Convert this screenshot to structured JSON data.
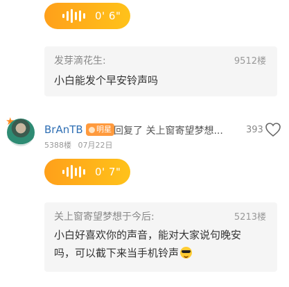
{
  "voice_messages": [
    {
      "duration": "0' 6\""
    },
    {
      "duration": "0' 7\""
    }
  ],
  "quotes": [
    {
      "author": "发芽滴花生:",
      "floor": "9512楼",
      "text": "小白能发个早安铃声吗"
    },
    {
      "author": "关上窗寄望梦想于今后:",
      "floor": "5213楼",
      "text_line1": "小白好喜欢你的声音，能对大家说句晚安",
      "text_line2": "吗，可以截下来当手机铃声",
      "emoji": "sunglasses-emoji"
    }
  ],
  "comment": {
    "username": "BrAnTB",
    "badge": "明星",
    "reply_text": "回复了 关上窗寄望梦想...",
    "likes": "393",
    "floor": "5388楼",
    "date": "07月22日"
  },
  "colors": {
    "voice_bubble": "#ffa01a",
    "username": "#2f6fb4",
    "badge": "#ff9a3d"
  },
  "icons": [
    "waveform-icon",
    "heart-icon",
    "star-icon"
  ]
}
